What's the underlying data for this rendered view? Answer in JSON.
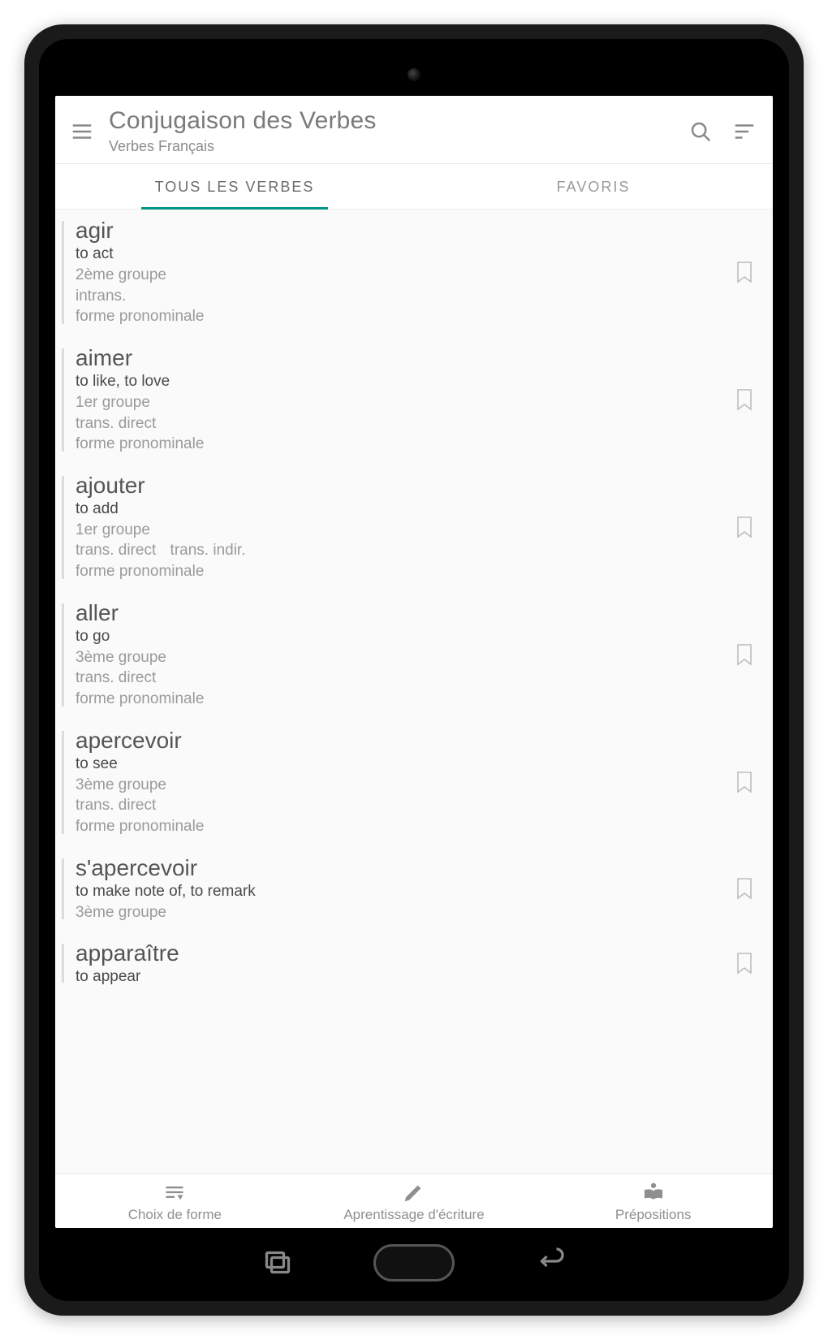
{
  "header": {
    "title": "Conjugaison des Verbes",
    "subtitle": "Verbes Français"
  },
  "tabs": {
    "all": "TOUS LES VERBES",
    "fav": "FAVORIS",
    "active": "all"
  },
  "verbs": [
    {
      "fr": "agir",
      "en": "to act",
      "group": "2ème groupe",
      "trans": "intrans.",
      "pron": "forme pronominale"
    },
    {
      "fr": "aimer",
      "en": "to like, to love",
      "group": "1er groupe",
      "trans": "trans. direct",
      "pron": "forme pronominale"
    },
    {
      "fr": "ajouter",
      "en": "to add",
      "group": "1er groupe",
      "trans": "trans. direct",
      "trans2": "trans. indir.",
      "pron": "forme pronominale"
    },
    {
      "fr": "aller",
      "en": "to go",
      "group": "3ème groupe",
      "trans": "trans. direct",
      "pron": "forme pronominale"
    },
    {
      "fr": "apercevoir",
      "en": "to see",
      "group": "3ème groupe",
      "trans": "trans. direct",
      "pron": "forme pronominale"
    },
    {
      "fr": "s'apercevoir",
      "en": "to make note of, to remark",
      "group": "3ème groupe"
    },
    {
      "fr": "apparaître",
      "en": "to appear"
    }
  ],
  "bottom": {
    "forme": "Choix de forme",
    "ecrit": "Aprentissage d'écriture",
    "prep": "Prépositions"
  }
}
